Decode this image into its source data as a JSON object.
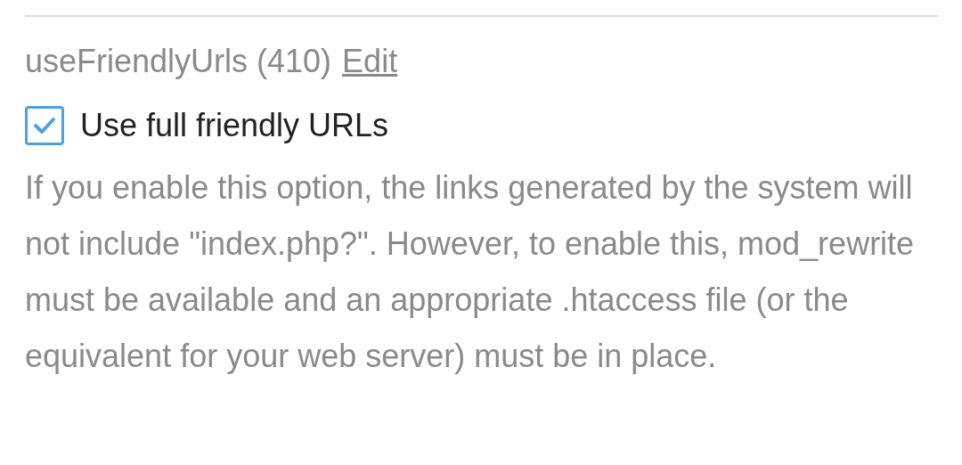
{
  "option": {
    "name": "useFriendlyUrls (410)",
    "edit_link": "Edit"
  },
  "checkbox": {
    "label": "Use full friendly URLs",
    "checked": true
  },
  "description": "If you enable this option, the links generated by the system will not include \"index.php?\". However, to enable this, mod_rewrite must be available and an appropriate .htaccess file (or the equivalent for your web server) must be in place."
}
